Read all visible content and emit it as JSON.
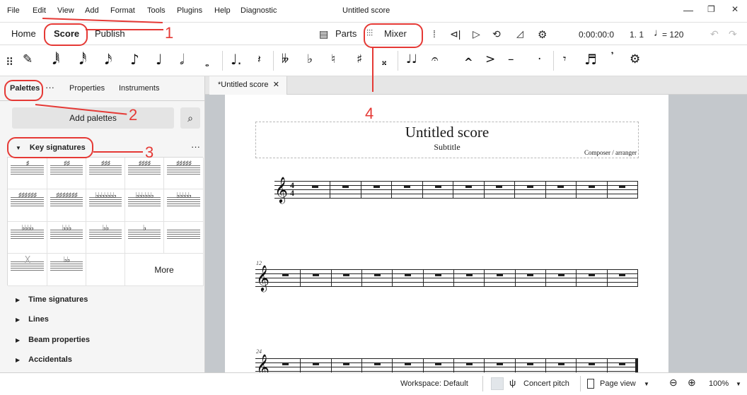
{
  "menubar": {
    "items": [
      "File",
      "Edit",
      "View",
      "Add",
      "Format",
      "Tools",
      "Plugins",
      "Help",
      "Diagnostic"
    ],
    "window_title": "Untitled score",
    "controls": [
      "—",
      "❐",
      "✕"
    ]
  },
  "nav": {
    "tabs": [
      "Home",
      "Score",
      "Publish"
    ],
    "active_tab": "Score",
    "parts_label": "Parts",
    "mixer_label": "Mixer",
    "time": "0:00:00:0",
    "position": "1. 1",
    "tempo": "= 120"
  },
  "notebar": {
    "glyphs": [
      "⠿",
      "✎",
      "𝅘𝅥𝅱",
      "𝅘𝅥𝅰",
      "𝅘𝅥𝅯",
      "♪",
      "♩",
      "𝅗𝅥",
      "𝅝",
      "♩.",
      "𝄽",
      "𝄫",
      "♭",
      "♮",
      "♯",
      "𝄪",
      "♩♩",
      "𝄐",
      "^",
      ">",
      "–",
      "·",
      "𝄾",
      "♬",
      "𝄒",
      "⚙"
    ]
  },
  "left_panel": {
    "tabs": [
      "Palettes",
      "···",
      "Properties",
      "Instruments"
    ],
    "active_tab": "Palettes",
    "add_palettes": "Add palettes",
    "search_icon": "search-icon",
    "key_signatures": "Key signatures",
    "more_menu": "···",
    "key_cells": [
      "♯",
      "♯♯",
      "♯♯♯",
      "♯♯♯♯",
      "♯♯♯♯♯",
      "♯♯♯♯♯♯",
      "♯♯♯♯♯♯♯",
      "♭♭♭♭♭♭♭",
      "♭♭♭♭♭♭",
      "♭♭♭♭♭",
      "♭♭♭♭",
      "♭♭♭",
      "♭♭",
      "♭",
      "",
      "X",
      "♭♭",
      "",
      "More"
    ],
    "sections": [
      "Time signatures",
      "Lines",
      "Beam properties",
      "Accidentals"
    ]
  },
  "score_tab": {
    "label": "*Untitled score",
    "close": "✕"
  },
  "score": {
    "title": "Untitled score",
    "subtitle": "Subtitle",
    "composer": "Composer / arranger",
    "clef": "𝄞",
    "time_sig_top": "4",
    "time_sig_bottom": "4",
    "measure_numbers": [
      "12",
      "24"
    ]
  },
  "statusbar": {
    "workspace": "Workspace: Default",
    "concert_pitch": "Concert pitch",
    "page_view": "Page view",
    "zoom": "100%"
  },
  "annotations": [
    "1",
    "2",
    "3",
    "4"
  ],
  "colors": {
    "annotation": "#e53935",
    "toolbar_bg": "#ffffff",
    "canvas_bg": "#c4c8cc"
  }
}
